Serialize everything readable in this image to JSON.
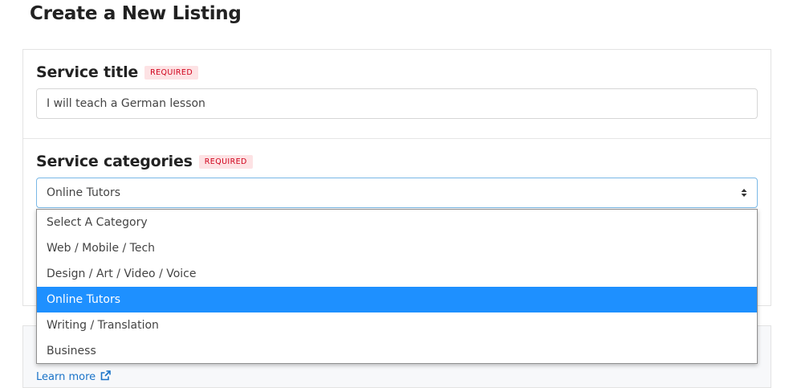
{
  "header": {
    "title": "Create a New Listing"
  },
  "service_title": {
    "label": "Service title",
    "badge": "REQUIRED",
    "value": "I will teach a German lesson"
  },
  "service_categories": {
    "label": "Service categories",
    "badge": "REQUIRED",
    "selected": "Online Tutors",
    "options": [
      "Select A Category",
      "Web / Mobile / Tech",
      "Design / Art / Video / Voice",
      "Online Tutors",
      "Writing / Translation",
      "Business"
    ],
    "selected_index": 3
  },
  "footer": {
    "learn_more": "Learn more"
  },
  "colors": {
    "accent": "#1e90ff",
    "link": "#1a73c8",
    "required_text": "#d0021b",
    "required_bg": "#fde2e4"
  },
  "icons": {
    "select_arrows": "sort-arrows-icon",
    "external_link": "external-link-icon"
  }
}
